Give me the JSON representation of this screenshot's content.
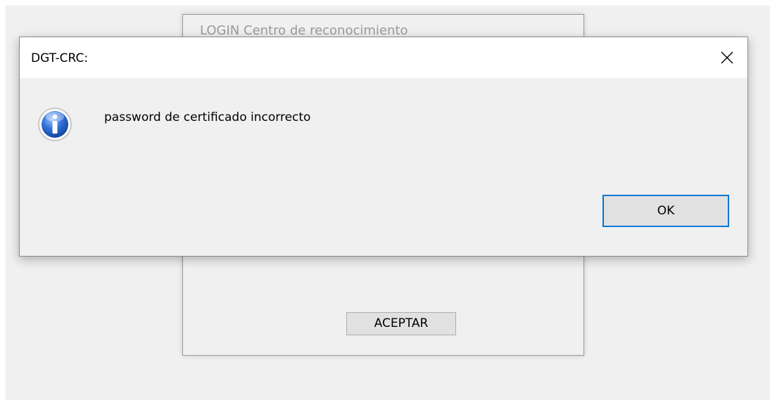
{
  "background_window": {
    "title": "LOGIN Centro de reconocimiento",
    "accept_label": "ACEPTAR"
  },
  "dialog": {
    "title": "DGT-CRC:",
    "message": "password de certificado incorrecto",
    "ok_label": "OK",
    "icon": "info-icon",
    "close_icon": "close-icon"
  },
  "colors": {
    "accent": "#0078d7",
    "dialog_bg": "#f0f0f0",
    "titlebar_bg": "#ffffff",
    "icon_blue": "#1f5fbf"
  }
}
